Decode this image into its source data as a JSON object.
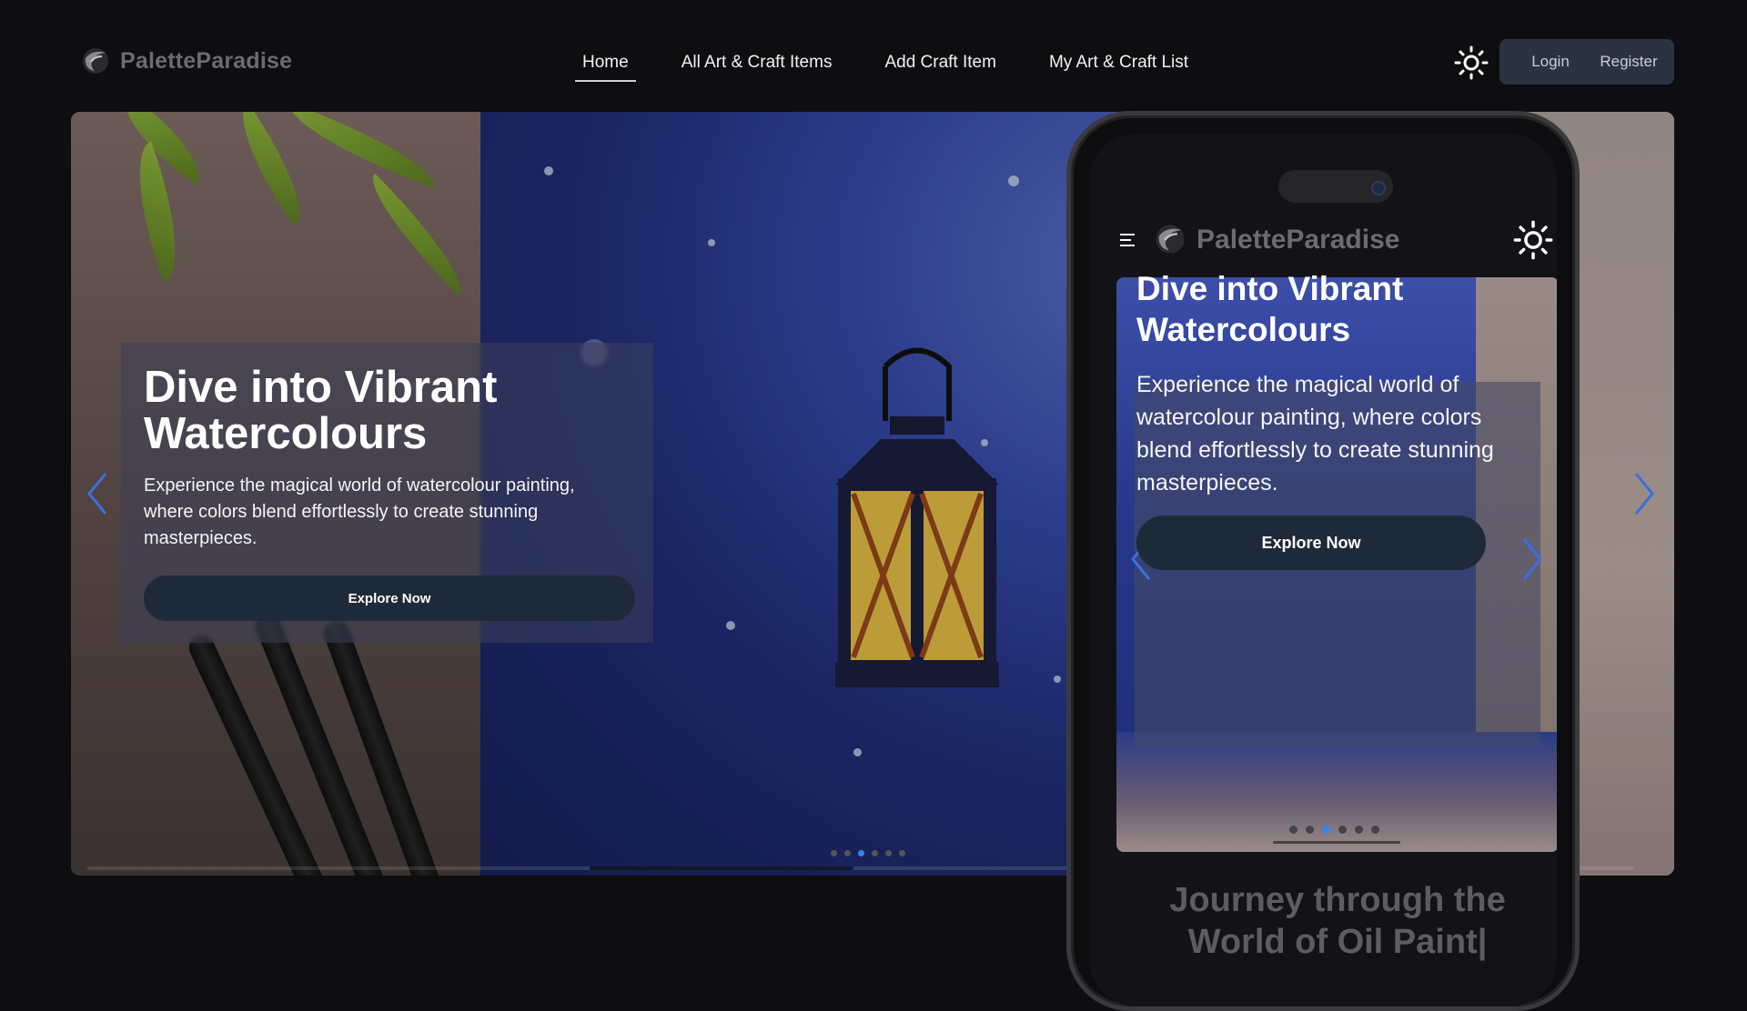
{
  "navbar": {
    "brand": "PaletteParadise",
    "links": [
      "Home",
      "All Art & Craft Items",
      "Add Craft Item",
      "My Art & Craft List"
    ],
    "active_link": "Home",
    "login": "Login",
    "register": "Register",
    "theme_icon": "sun-icon"
  },
  "hero": {
    "title": "Dive into Vibrant Watercolours",
    "description": "Experience the magical world of watercolour painting, where colors blend effortlessly to create stunning masterpieces.",
    "button": "Explore Now",
    "slide_count": 6,
    "active_slide": 0
  },
  "phone": {
    "brand": "PaletteParadise",
    "hero_title": "Dive into Vibrant Watercolours",
    "hero_description": "Experience the magical world of watercolour painting, where colors blend effortlessly to create stunning masterpieces.",
    "hero_button": "Explore Now",
    "next_heading": "Journey through the World of Oil Paint|"
  },
  "colors": {
    "background": "#0e0d10",
    "button_bg": "#2a3441",
    "accent": "#3b82f6",
    "muted_brand": "#6b6b72"
  }
}
